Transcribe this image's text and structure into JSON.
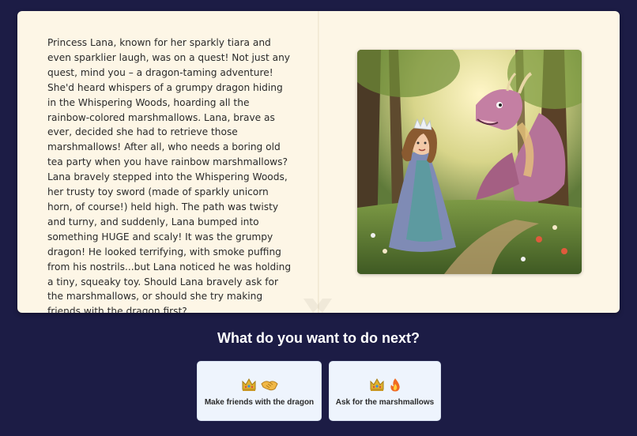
{
  "story": {
    "text": "Princess Lana, known for her sparkly tiara and even sparklier laugh, was on a quest! Not just any quest, mind you – a dragon-taming adventure! She'd heard whispers of a grumpy dragon hiding in the Whispering Woods, hoarding all the rainbow-colored marshmallows. Lana, brave as ever, decided she had to retrieve those marshmallows! After all, who needs a boring old tea party when you have rainbow marshmallows? Lana bravely stepped into the Whispering Woods, her trusty toy sword (made of sparkly unicorn horn, of course!) held high. The path was twisty and turny, and suddenly, Lana bumped into something HUGE and scaly! It was the grumpy dragon! He looked terrifying, with smoke puffing from his nostrils...but Lana noticed he was holding a tiny, squeaky toy. Should Lana bravely ask for the marshmallows, or should she try making friends with the dragon first?"
  },
  "illustration": {
    "icon": "princess-and-dragon-illustration"
  },
  "prompt": {
    "title": "What do you want to do next?"
  },
  "choices": [
    {
      "icons": [
        "crown-icon",
        "handshake-icon"
      ],
      "label": "Make friends with the dragon"
    },
    {
      "icons": [
        "crown-icon",
        "fire-icon"
      ],
      "label": "Ask for the marshmallows"
    }
  ],
  "colors": {
    "background": "#1c1c45",
    "page": "#fdf6e6",
    "card": "#eef4fd"
  }
}
